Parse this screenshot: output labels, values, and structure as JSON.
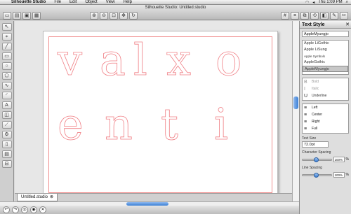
{
  "menubar": {
    "app": "Silhouette Studio",
    "menus": [
      "File",
      "Edit",
      "Object",
      "View",
      "Help"
    ],
    "clock": "Thu 1:09 PM"
  },
  "window": {
    "title": "Silhouette Studio: Untitled.studio"
  },
  "toolbar": {
    "left_icons": [
      "new-doc-icon",
      "open-folder-icon",
      "save-icon",
      "print-icon"
    ],
    "mid_icons": [
      "zoom-in-icon",
      "zoom-out-icon",
      "zoom-fit-icon",
      "pan-icon",
      "redraw-icon"
    ],
    "right_icons": [
      "grid-icon",
      "align-icon",
      "replicate-icon",
      "transform-icon",
      "fill-color-icon",
      "line-color-icon",
      "send-to-cutter-icon"
    ]
  },
  "canvas": {
    "letters": [
      {
        "ch": "v"
      },
      {
        "ch": "a"
      },
      {
        "ch": "l"
      },
      {
        "ch": "x"
      },
      {
        "ch": "o"
      },
      {
        "ch": "e"
      },
      {
        "ch": "n"
      },
      {
        "ch": "t"
      },
      {
        "ch": "i"
      }
    ],
    "text_color": "#f07f85"
  },
  "tabs": {
    "document": "Untitled.studio"
  },
  "panel": {
    "title": "Text Style",
    "font_name": "AppleMyungjo",
    "fonts": [
      "Apple LiGothic",
      "Apple LiSung",
      "Apple Symbols",
      "AppleGothic",
      "AppleMyungjo"
    ],
    "selected_font": "AppleMyungjo",
    "styles": [
      {
        "icon": "B",
        "label": "Bold",
        "enabled": false
      },
      {
        "icon": "I",
        "label": "Italic",
        "enabled": false
      },
      {
        "icon": "U",
        "label": "Underline",
        "enabled": true
      }
    ],
    "align": [
      "Left",
      "Center",
      "Right",
      "Full"
    ],
    "text_size_label": "Text Size",
    "text_size": "72.0pt",
    "char_spacing_label": "Character Spacing",
    "char_spacing": "100%",
    "line_spacing_label": "Line Spacing",
    "line_spacing": "100%",
    "char_spacing_level": 0.5,
    "line_spacing_level": 0.5
  }
}
